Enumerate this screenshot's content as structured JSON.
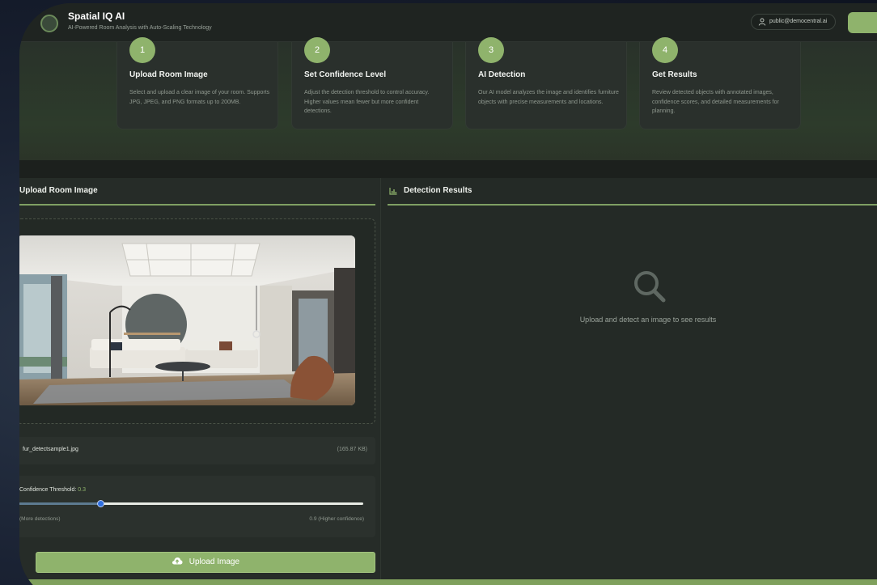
{
  "header": {
    "title": "Spatial IQ AI",
    "subtitle": "AI-Powered Room Analysis with Auto-Scaling Technology",
    "user_email": "public@democentral.ai"
  },
  "steps": [
    {
      "num": "1",
      "title": "Upload Room Image",
      "desc": "Select and upload a clear image of your room. Supports JPG, JPEG, and PNG formats up to 200MB."
    },
    {
      "num": "2",
      "title": "Set Confidence Level",
      "desc": "Adjust the detection threshold to control accuracy. Higher values mean fewer but more confident detections."
    },
    {
      "num": "3",
      "title": "AI Detection",
      "desc": "Our AI model analyzes the image and identifies furniture objects with precise measurements and locations."
    },
    {
      "num": "4",
      "title": "Get Results",
      "desc": "Review detected objects with annotated images, confidence scores, and detailed measurements for planning."
    }
  ],
  "upload_panel": {
    "title": "Upload Room Image",
    "file_name": "fur_detectsample1.jpg",
    "file_size": "(165.87 KB)",
    "threshold_label": "Confidence Threshold:",
    "threshold_value": "0.3",
    "threshold_fraction": 0.235,
    "threshold_min_label": "(More detections)",
    "threshold_max_label": "0.9 (Higher confidence)",
    "upload_button": "Upload Image"
  },
  "results_panel": {
    "title": "Detection Results",
    "empty_message": "Upload and detect an image to see results"
  },
  "colors": {
    "accent": "#8fb36c",
    "background": "#252b27",
    "slider_thumb": "#2f6fe0"
  },
  "icons": {
    "user": "user-icon",
    "results": "bar-chart-icon",
    "empty": "search-icon",
    "upload": "cloud-upload-icon"
  }
}
